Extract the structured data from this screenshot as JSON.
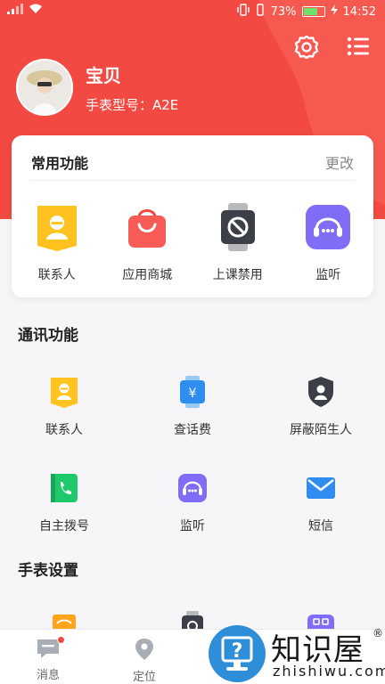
{
  "status_bar": {
    "battery_percent_label": "73%",
    "time": "14:52",
    "battery_fill": 0.73
  },
  "profile": {
    "name": "宝贝",
    "model_label": "手表型号：A2E"
  },
  "common_functions": {
    "title": "常用功能",
    "action": "更改",
    "items": [
      {
        "label": "联系人",
        "icon": "contacts-icon"
      },
      {
        "label": "应用商城",
        "icon": "app-store-icon"
      },
      {
        "label": "上课禁用",
        "icon": "class-disable-icon"
      },
      {
        "label": "监听",
        "icon": "listen-icon"
      }
    ]
  },
  "communication": {
    "title": "通讯功能",
    "rows": [
      [
        {
          "label": "联系人",
          "icon": "contacts-icon"
        },
        {
          "label": "查话费",
          "icon": "phone-bill-icon"
        },
        {
          "label": "屏蔽陌生人",
          "icon": "block-stranger-icon"
        }
      ],
      [
        {
          "label": "自主拨号",
          "icon": "dial-icon"
        },
        {
          "label": "监听",
          "icon": "listen-icon"
        },
        {
          "label": "短信",
          "icon": "sms-icon"
        }
      ]
    ]
  },
  "watch_settings": {
    "title": "手表设置"
  },
  "tabbar": [
    {
      "label": "消息",
      "icon": "message-icon"
    },
    {
      "label": "定位",
      "icon": "location-icon"
    }
  ],
  "watermark": {
    "title": "知识屋",
    "subtitle": "zhishiwu.com",
    "registered": "®"
  },
  "colors": {
    "brand": "#f24a43",
    "yellow": "#ffc21f",
    "purple": "#7f6df5",
    "green": "#1fc96b",
    "blue": "#2f8df0",
    "dark": "#3c3f48"
  }
}
